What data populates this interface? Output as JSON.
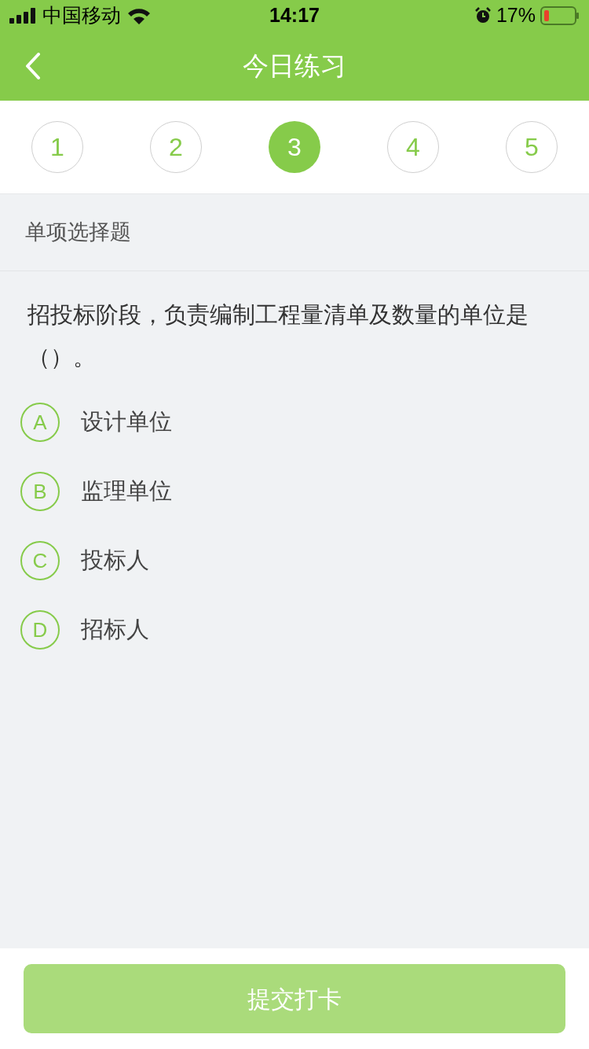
{
  "status_bar": {
    "carrier": "中国移动",
    "time": "14:17",
    "battery": "17%"
  },
  "header": {
    "title": "今日练习"
  },
  "steps": [
    {
      "label": "1",
      "selected": false
    },
    {
      "label": "2",
      "selected": false
    },
    {
      "label": "3",
      "selected": true
    },
    {
      "label": "4",
      "selected": false
    },
    {
      "label": "5",
      "selected": false
    }
  ],
  "section": {
    "title": "单项选择题"
  },
  "question": {
    "text": "招投标阶段，负责编制工程量清单及数量的单位是（）。",
    "options": [
      {
        "letter": "A",
        "text": "设计单位",
        "selected": false
      },
      {
        "letter": "B",
        "text": "监理单位",
        "selected": false
      },
      {
        "letter": "C",
        "text": "投标人",
        "selected": false
      },
      {
        "letter": "D",
        "text": "招标人",
        "selected": false
      }
    ]
  },
  "submit": {
    "label": "提交打卡",
    "disabled": true
  }
}
